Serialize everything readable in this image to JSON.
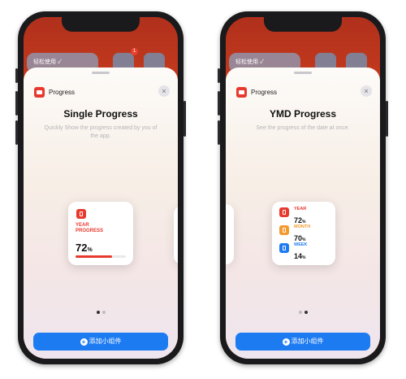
{
  "left": {
    "app_name": "Progress",
    "close": "×",
    "title": "Single Progress",
    "description": "Quickly Show the progress created by you of the app.",
    "bg_widget_text": "轻松使用 ✓",
    "badge": "1",
    "widget": {
      "label_line1": "YEAR",
      "label_line2": "PROGRESS",
      "value": "72",
      "unit": "%",
      "progress": 0.72
    },
    "add_button": "添加小组件"
  },
  "right": {
    "app_name": "Progress",
    "close": "×",
    "title": "YMD Progress",
    "description": "See the progress of the date at once.",
    "bg_widget_text": "轻松使用 ✓",
    "add_button": "添加小组件",
    "items": [
      {
        "label": "YEAR",
        "value": "72",
        "unit": "%",
        "color": "#e8392f"
      },
      {
        "label": "MONTH",
        "value": "70",
        "unit": "%",
        "color": "#f29a2e"
      },
      {
        "label": "WEEK",
        "value": "14",
        "unit": "%",
        "color": "#1d7bf2"
      }
    ]
  },
  "colors": {
    "accent_red": "#e8392f",
    "accent_blue": "#1d7bf2",
    "accent_orange": "#f29a2e"
  }
}
